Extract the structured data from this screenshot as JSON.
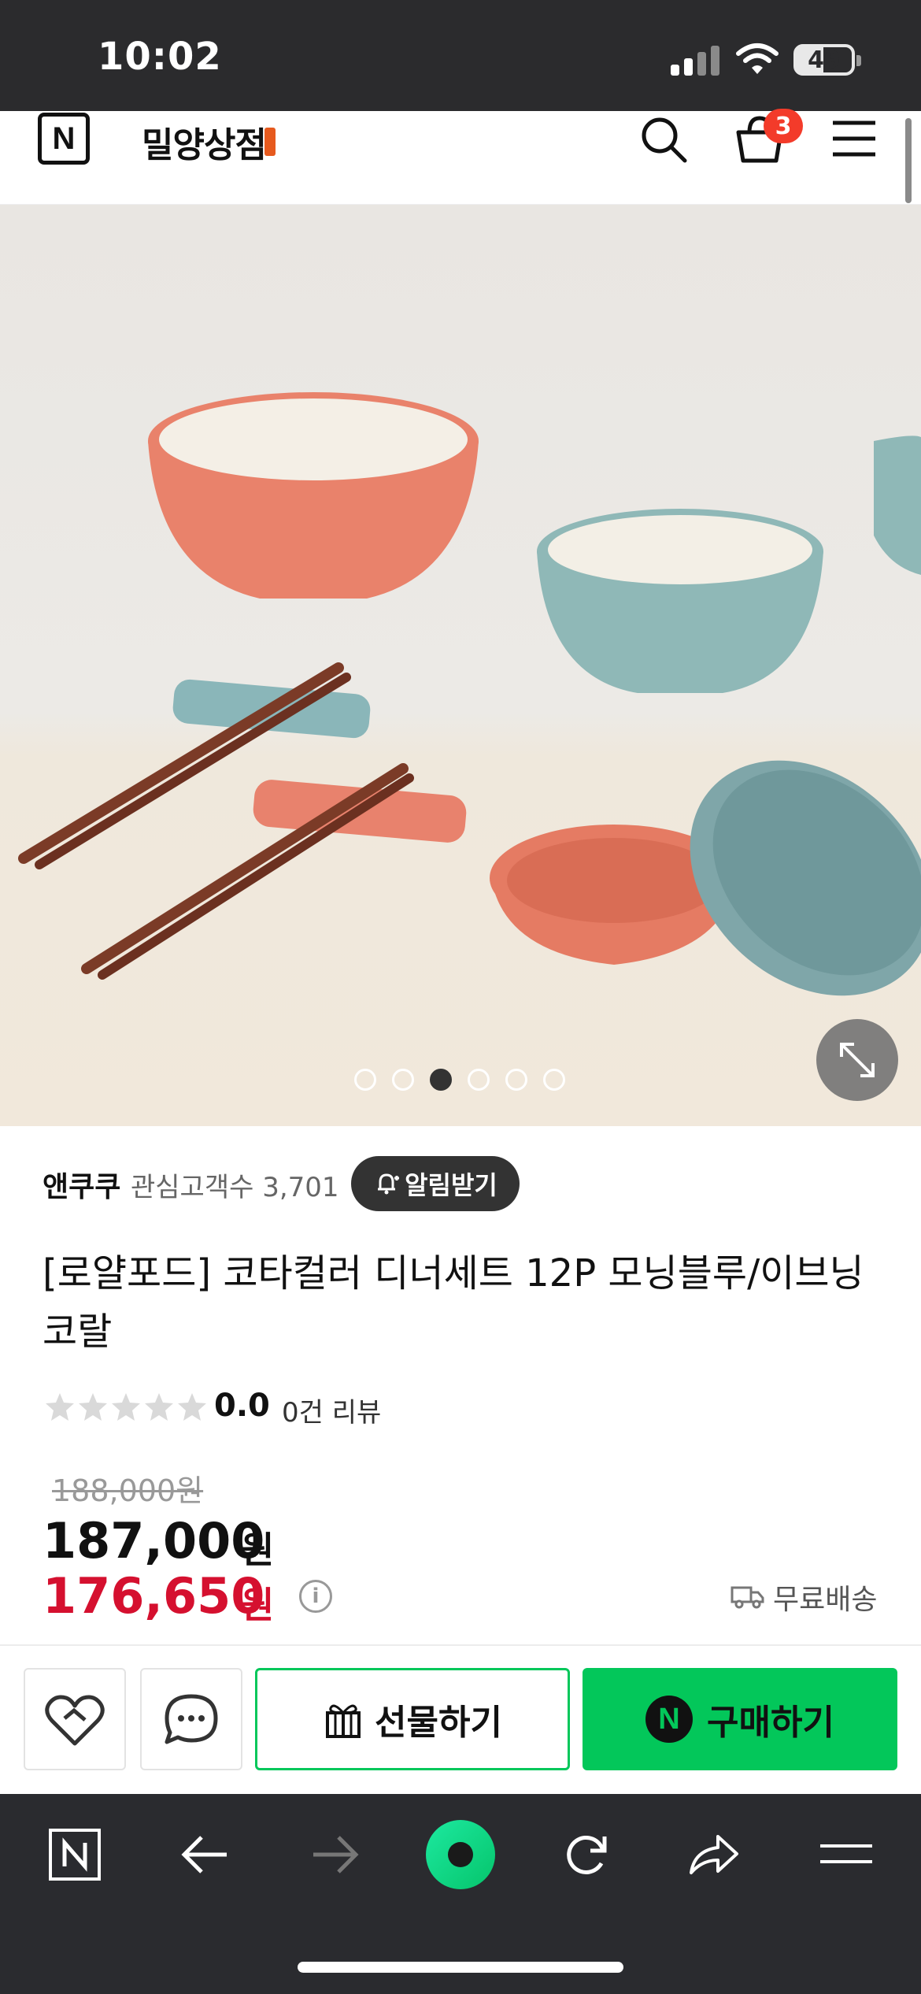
{
  "status_bar": {
    "time": "10:02",
    "battery": "49"
  },
  "header": {
    "store_name": "밀양상점",
    "cart_count": "3"
  },
  "gallery": {
    "image_count": 6,
    "active_index": 2
  },
  "seller": {
    "name": "앤쿠쿠",
    "interest_label": "관심고객수 3,701",
    "alarm_button": "알림받기"
  },
  "product": {
    "title": "[로얄포드] 코타컬러 디너세트 12P 모닝블루/이브닝코랄",
    "rating": "0.0",
    "rating_stars": 0,
    "review_count": "0건 리뷰",
    "original_price": "188,000원",
    "price": "187,000",
    "price_unit": "원",
    "sale_price": "176,650",
    "sale_unit": "원",
    "info_icon": "i",
    "shipping": "무료배송"
  },
  "actions": {
    "gift_label": "선물하기",
    "buy_label": "구매하기",
    "buy_badge": "N"
  },
  "colors": {
    "naver_green": "#03c75a",
    "sale_red": "#d5102f",
    "badge_red": "#f33b2a",
    "browser_bar": "#2a2b2f"
  },
  "icons": [
    "search-icon",
    "cart-icon",
    "menu-icon",
    "zoom-icon",
    "bell-icon",
    "star-icon",
    "info-icon",
    "truck-icon",
    "heart-icon",
    "chat-icon",
    "gift-icon",
    "back-icon",
    "forward-icon",
    "home-icon",
    "refresh-icon",
    "share-icon",
    "menu-icon"
  ]
}
